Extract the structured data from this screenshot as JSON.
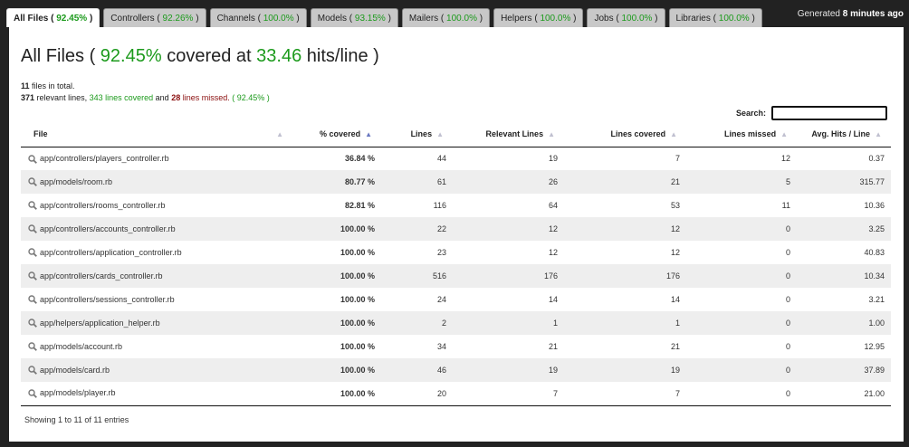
{
  "tabs": [
    {
      "label": "All Files",
      "pct": "92.45%",
      "pct_color": "green",
      "active": true
    },
    {
      "label": "Controllers",
      "pct": "92.26%",
      "pct_color": "green",
      "active": false
    },
    {
      "label": "Channels",
      "pct": "100.0%",
      "pct_color": "green",
      "active": false
    },
    {
      "label": "Models",
      "pct": "93.15%",
      "pct_color": "green",
      "active": false
    },
    {
      "label": "Mailers",
      "pct": "100.0%",
      "pct_color": "green",
      "active": false
    },
    {
      "label": "Helpers",
      "pct": "100.0%",
      "pct_color": "green",
      "active": false
    },
    {
      "label": "Jobs",
      "pct": "100.0%",
      "pct_color": "green",
      "active": false
    },
    {
      "label": "Libraries",
      "pct": "100.0%",
      "pct_color": "green",
      "active": false
    }
  ],
  "generated": {
    "prefix": "Generated",
    "time": "8 minutes ago"
  },
  "title": {
    "label": "All Files",
    "pct": "92.45%",
    "middle": "covered at",
    "hits": "33.46",
    "suffix": "hits/line"
  },
  "summary": {
    "files_count": "11",
    "files_text": "files in total.",
    "relevant_count": "371",
    "relevant_text": "relevant lines,",
    "covered_text": "343 lines covered",
    "and_text": "and",
    "missed_count": "28",
    "missed_text": "lines missed.",
    "pct_text": "( 92.45% )"
  },
  "search": {
    "label": "Search:",
    "value": ""
  },
  "table": {
    "columns": [
      "File",
      "% covered",
      "Lines",
      "Relevant Lines",
      "Lines covered",
      "Lines missed",
      "Avg. Hits / Line"
    ],
    "rows": [
      {
        "file": "app/controllers/players_controller.rb",
        "pct": "36.84 %",
        "pct_color": "red",
        "lines": "44",
        "relevant": "19",
        "covered": "7",
        "missed": "12",
        "avg": "0.37"
      },
      {
        "file": "app/models/room.rb",
        "pct": "80.77 %",
        "pct_color": "yellow",
        "lines": "61",
        "relevant": "26",
        "covered": "21",
        "missed": "5",
        "avg": "315.77"
      },
      {
        "file": "app/controllers/rooms_controller.rb",
        "pct": "82.81 %",
        "pct_color": "yellow",
        "lines": "116",
        "relevant": "64",
        "covered": "53",
        "missed": "11",
        "avg": "10.36"
      },
      {
        "file": "app/controllers/accounts_controller.rb",
        "pct": "100.00 %",
        "pct_color": "green",
        "lines": "22",
        "relevant": "12",
        "covered": "12",
        "missed": "0",
        "avg": "3.25"
      },
      {
        "file": "app/controllers/application_controller.rb",
        "pct": "100.00 %",
        "pct_color": "green",
        "lines": "23",
        "relevant": "12",
        "covered": "12",
        "missed": "0",
        "avg": "40.83"
      },
      {
        "file": "app/controllers/cards_controller.rb",
        "pct": "100.00 %",
        "pct_color": "green",
        "lines": "516",
        "relevant": "176",
        "covered": "176",
        "missed": "0",
        "avg": "10.34"
      },
      {
        "file": "app/controllers/sessions_controller.rb",
        "pct": "100.00 %",
        "pct_color": "green",
        "lines": "24",
        "relevant": "14",
        "covered": "14",
        "missed": "0",
        "avg": "3.21"
      },
      {
        "file": "app/helpers/application_helper.rb",
        "pct": "100.00 %",
        "pct_color": "green",
        "lines": "2",
        "relevant": "1",
        "covered": "1",
        "missed": "0",
        "avg": "1.00"
      },
      {
        "file": "app/models/account.rb",
        "pct": "100.00 %",
        "pct_color": "green",
        "lines": "34",
        "relevant": "21",
        "covered": "21",
        "missed": "0",
        "avg": "12.95"
      },
      {
        "file": "app/models/card.rb",
        "pct": "100.00 %",
        "pct_color": "green",
        "lines": "46",
        "relevant": "19",
        "covered": "19",
        "missed": "0",
        "avg": "37.89"
      },
      {
        "file": "app/models/player.rb",
        "pct": "100.00 %",
        "pct_color": "green",
        "lines": "20",
        "relevant": "7",
        "covered": "7",
        "missed": "0",
        "avg": "21.00"
      }
    ]
  },
  "footer": {
    "entries": "Showing 1 to 11 of 11 entries"
  },
  "colors": {
    "green": "#1c9a1c",
    "red": "#8a0d0d",
    "yellow": "#d4a40d",
    "background": "#222222"
  }
}
